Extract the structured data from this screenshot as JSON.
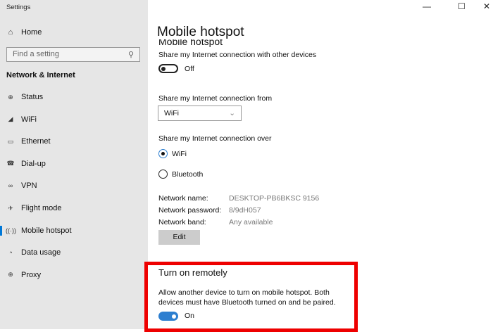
{
  "window": {
    "title": "Settings",
    "minimize": "—",
    "maximize": "☐",
    "close": "✕"
  },
  "sidebar": {
    "home": "Home",
    "search_placeholder": "Find a setting",
    "section": "Network & Internet",
    "items": [
      {
        "label": "Status",
        "icon": "status-globe-icon",
        "glyph": "⊕"
      },
      {
        "label": "WiFi",
        "icon": "wifi-icon",
        "glyph": "◢"
      },
      {
        "label": "Ethernet",
        "icon": "ethernet-icon",
        "glyph": "▭"
      },
      {
        "label": "Dial-up",
        "icon": "dialup-icon",
        "glyph": "☎"
      },
      {
        "label": "VPN",
        "icon": "vpn-icon",
        "glyph": "∞"
      },
      {
        "label": "Flight mode",
        "icon": "airplane-icon",
        "glyph": "✈"
      },
      {
        "label": "Mobile hotspot",
        "icon": "hotspot-icon",
        "glyph": "((·))"
      },
      {
        "label": "Data usage",
        "icon": "data-usage-icon",
        "glyph": "◔"
      },
      {
        "label": "Proxy",
        "icon": "proxy-globe-icon",
        "glyph": "⊕"
      }
    ]
  },
  "main": {
    "title": "Mobile hotspot",
    "subtitle": "Mobile hotspot",
    "share_label": "Share my Internet connection with other devices",
    "share_state": "Off",
    "from_label": "Share my Internet connection from",
    "from_value": "WiFi",
    "over_label": "Share my Internet connection over",
    "over_options": [
      "WiFi",
      "Bluetooth"
    ],
    "network_name_label": "Network name:",
    "network_name": "DESKTOP-PB6BKSC 9156",
    "network_password_label": "Network password:",
    "network_password": "8/9dH057",
    "network_band_label": "Network band:",
    "network_band": "Any available",
    "edit": "Edit",
    "remote_title": "Turn on remotely",
    "remote_desc": "Allow another device to turn on mobile hotspot. Both devices must have Bluetooth turned on and be paired.",
    "remote_state": "On"
  },
  "colors": {
    "accent": "#2d7fd0",
    "highlight": "#ee0000"
  }
}
